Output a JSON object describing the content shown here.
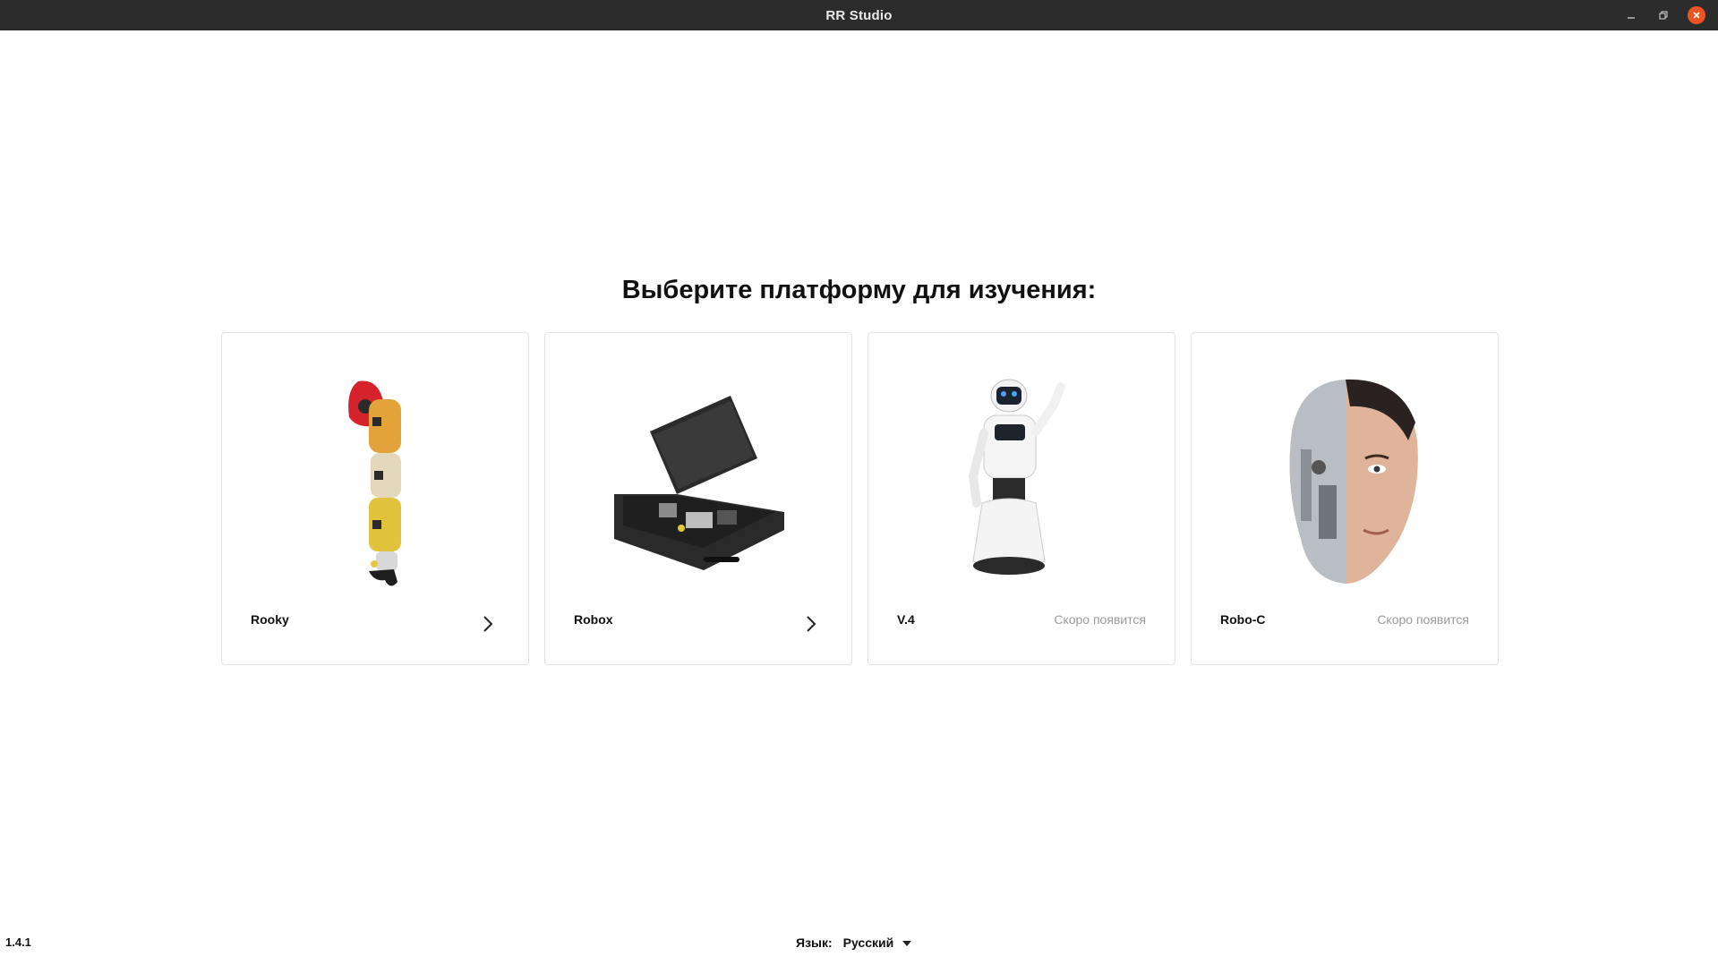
{
  "window": {
    "title": "RR Studio"
  },
  "main": {
    "heading": "Выберите платформу для изучения:"
  },
  "cards": [
    {
      "name": "Rooky",
      "status": "",
      "icon": "robot-arm-image"
    },
    {
      "name": "Robox",
      "status": "",
      "icon": "hard-case-kit-image"
    },
    {
      "name": "V.4",
      "status": "Скоро появится",
      "icon": "promobot-v4-image"
    },
    {
      "name": "Robo-C",
      "status": "Скоро появится",
      "icon": "android-face-image"
    }
  ],
  "footer": {
    "version": "1.4.1",
    "language_label": "Язык:",
    "language_value": "Русский"
  },
  "colors": {
    "titlebar_bg": "#2d2c2c",
    "close_btn": "#e95420",
    "muted_text": "#9a9a9a",
    "card_border": "#e3e3e3"
  }
}
